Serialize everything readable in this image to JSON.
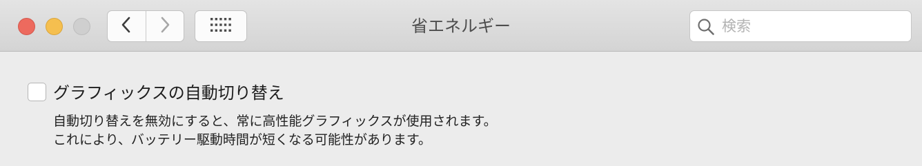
{
  "window": {
    "title": "省エネルギー"
  },
  "toolbar": {
    "back_icon": "chevron-left-icon",
    "forward_icon": "chevron-right-icon",
    "show_all_icon": "grid-icon"
  },
  "search": {
    "placeholder": "検索",
    "value": "",
    "icon": "search-icon"
  },
  "options": {
    "auto_graphics_switching": {
      "label": "グラフィックスの自動切り替え",
      "checked": false,
      "description_line1": "自動切り替えを無効にすると、常に高性能グラフィックスが使用されます。",
      "description_line2": "これにより、バッテリー駆動時間が短くなる可能性があります。"
    }
  },
  "colors": {
    "close": "#ed6a5e",
    "minimize": "#f5bf4f",
    "zoom_disabled": "#cfcfcf"
  }
}
